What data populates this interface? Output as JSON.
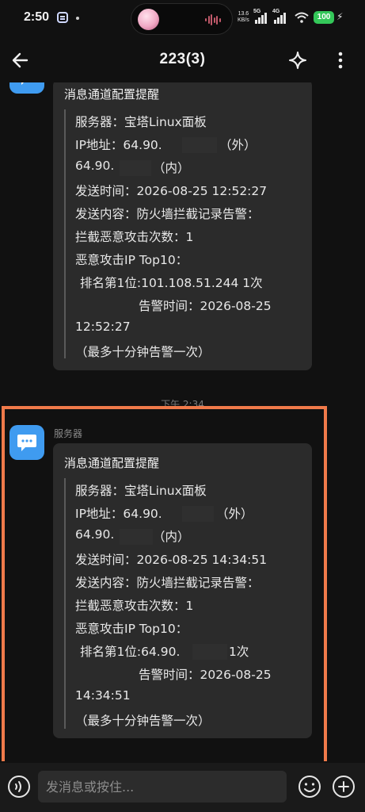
{
  "status_bar": {
    "time": "2:50",
    "net_speed_value": "13.6",
    "net_speed_unit": "KB/s",
    "network_5g": "5G",
    "network_4g": "4G",
    "battery": "100",
    "icons": [
      "app-notification-icon",
      "music-wave-icon",
      "signal-icon",
      "wifi-icon",
      "battery-icon",
      "charging-icon"
    ]
  },
  "header": {
    "title": "223(3)",
    "icons": [
      "back-arrow-icon",
      "sparkle-icon",
      "more-vertical-icon"
    ]
  },
  "messages": [
    {
      "title": "消息通道配置提醒",
      "lines": [
        "服务器：宝塔Linux面板",
        "IP地址：64.90.",
        "（外）",
        "64.90.",
        "（内）",
        "发送时间：2026-08-25 12:52:27",
        "发送内容：防火墙拦截记录告警：",
        "拦截恶意攻击次数：1",
        "恶意攻击IP Top10：",
        "排名第1位:101.108.51.244 1次",
        "告警时间：2026-08-25",
        "12:52:27",
        "（最多十分钟告警一次）"
      ]
    },
    {
      "sender": "服务器",
      "title": "消息通道配置提醒",
      "lines": [
        "服务器：宝塔Linux面板",
        "IP地址：64.90.",
        "（外）",
        "64.90.",
        "（内）",
        "发送时间：2026-08-25 14:34:51",
        "发送内容：防火墙拦截记录告警：",
        "拦截恶意攻击次数：1",
        "恶意攻击IP Top10：",
        "排名第1位:64.90.",
        "1次",
        "告警时间：2026-08-25",
        "14:34:51",
        "（最多十分钟告警一次）"
      ]
    }
  ],
  "timestamp": "下午 2:34",
  "input_bar": {
    "placeholder": "发消息或按住...",
    "icons": [
      "voice-icon",
      "emoji-icon",
      "plus-icon"
    ]
  },
  "colors": {
    "background": "#111111",
    "bubble": "#2b2b2b",
    "avatar": "#3f9bf0",
    "highlight": "#f07a4a",
    "battery": "#34c759"
  }
}
